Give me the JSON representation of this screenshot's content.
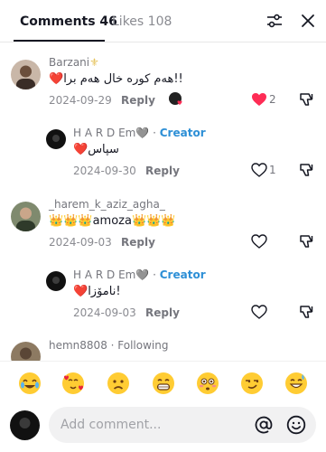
{
  "tabs": {
    "comments": "Comments 46",
    "likes": "Likes 108"
  },
  "comments": [
    {
      "username": "Barzani",
      "text": "هەم کورە خال هەم برا!!",
      "date": "2024-09-29",
      "reply": "Reply",
      "likes": "2",
      "liked": true,
      "creator_liked": true
    },
    {
      "username": "H A R D Em",
      "badge": "Creator",
      "text": "سپاس",
      "date": "2024-09-30",
      "reply": "Reply",
      "likes": "1"
    },
    {
      "username": "_harem_k_aziz_agha_",
      "text": "amoza",
      "date": "2024-09-03",
      "reply": "Reply",
      "likes": ""
    },
    {
      "username": "H A R D Em",
      "badge": "Creator",
      "text": "نامۆزا!",
      "date": "2024-09-03",
      "reply": "Reply",
      "likes": ""
    },
    {
      "username": "hemn8808",
      "badge": "Following"
    }
  ],
  "emoji_bar": [
    "😂",
    "🥰",
    "☹️",
    "😁",
    "😳",
    "😏",
    "😅"
  ],
  "input": {
    "placeholder": "Add comment..."
  },
  "colors": {
    "creator": "#2d8fd6",
    "like": "#fe2c55",
    "muted": "#8a8b91"
  }
}
